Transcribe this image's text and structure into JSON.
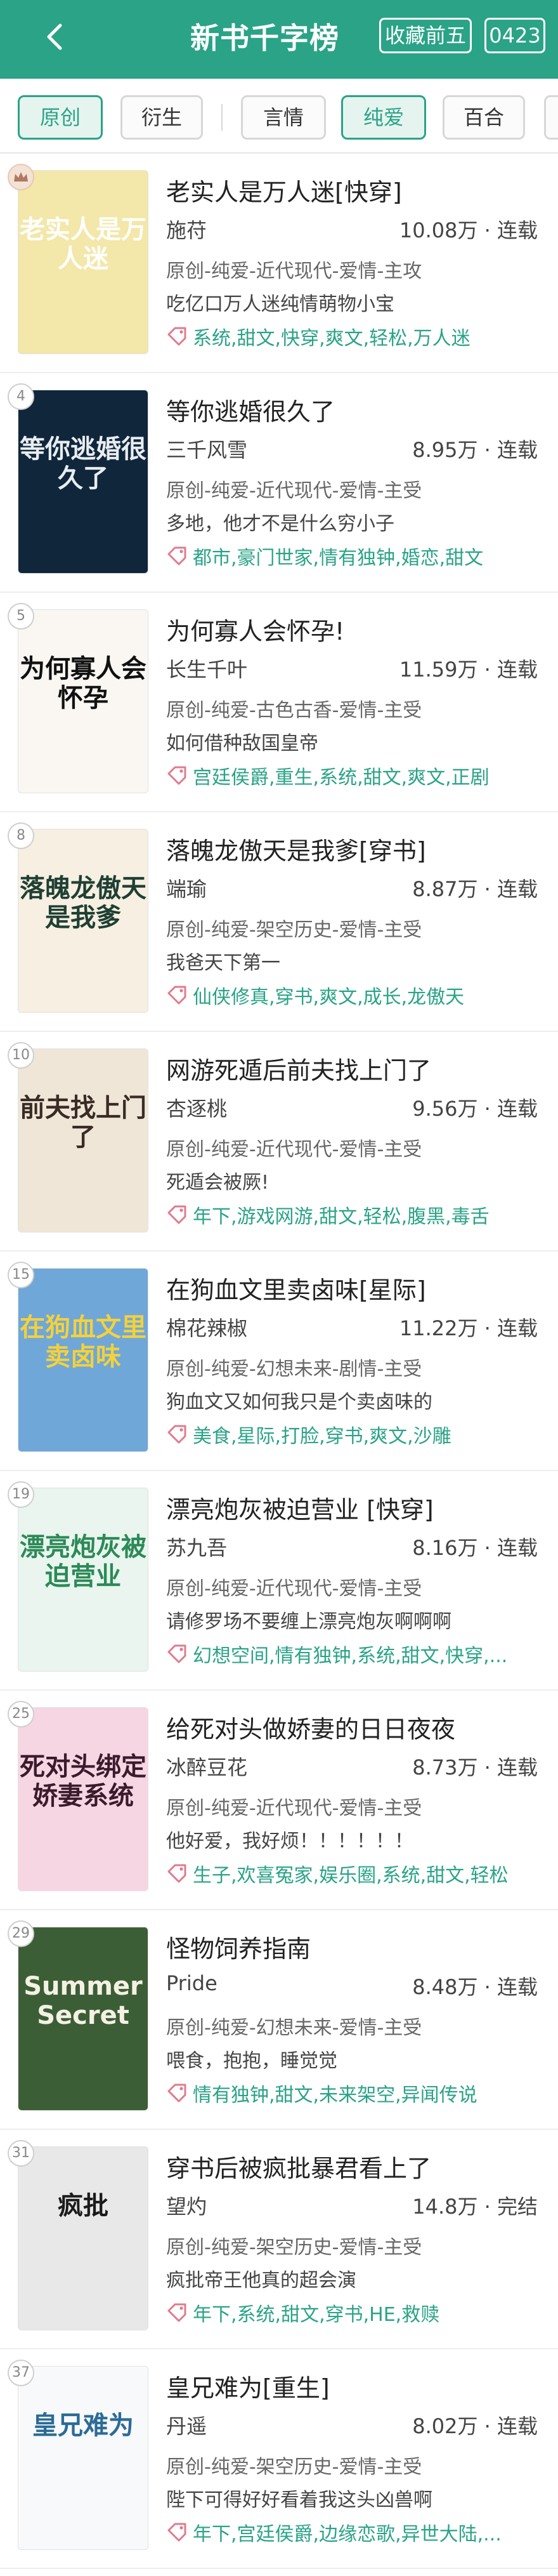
{
  "header": {
    "title": "新书千字榜",
    "left_badge": "收藏前五",
    "right_badge": "0423"
  },
  "tabs": [
    "原创",
    "衍生",
    "言情",
    "纯爱",
    "百合",
    ""
  ],
  "books": [
    {
      "rank": "",
      "title": "老实人是万人迷[快穿]",
      "author": "施苻",
      "stats": "10.08万 · 连载",
      "genre": "原创-纯爱-近代现代-爱情-主攻",
      "intro": "吃亿口万人迷纯情萌物小宝",
      "tags": "系统,甜文,快穿,爽文,轻松,万人迷",
      "cover": {
        "text": "老实人是万人迷",
        "bg": "#f3e7a9",
        "fg": "#ffffff"
      }
    },
    {
      "rank": "4",
      "title": "等你逃婚很久了",
      "author": "三千风雪",
      "stats": "8.95万 · 连载",
      "genre": "原创-纯爱-近代现代-爱情-主受",
      "intro": "多地，他才不是什么穷小子",
      "tags": "都市,豪门世家,情有独钟,婚恋,甜文",
      "cover": {
        "text": "等你逃婚很久了",
        "bg": "#10263a",
        "fg": "#e8edf2"
      }
    },
    {
      "rank": "5",
      "title": "为何寡人会怀孕!",
      "author": "长生千叶",
      "stats": "11.59万 · 连载",
      "genre": "原创-纯爱-古色古香-爱情-主受",
      "intro": "如何借种敌国皇帝",
      "tags": "宫廷侯爵,重生,系统,甜文,爽文,正剧",
      "cover": {
        "text": "为何寡人会怀孕",
        "bg": "#faf7f2",
        "fg": "#111111"
      }
    },
    {
      "rank": "8",
      "title": "落魄龙傲天是我爹[穿书]",
      "author": "端瑜",
      "stats": "8.87万 · 连载",
      "genre": "原创-纯爱-架空历史-爱情-主受",
      "intro": "我爸天下第一",
      "tags": "仙侠修真,穿书,爽文,成长,龙傲天",
      "cover": {
        "text": "落魄龙傲天是我爹",
        "bg": "#f6efe2",
        "fg": "#1f3f33"
      }
    },
    {
      "rank": "10",
      "title": "网游死遁后前夫找上门了",
      "author": "杏逐桃",
      "stats": "9.56万 · 连载",
      "genre": "原创-纯爱-近代现代-爱情-主受",
      "intro": "死遁会被厥!",
      "tags": "年下,游戏网游,甜文,轻松,腹黑,毒舌",
      "cover": {
        "text": "前夫找上门了",
        "bg": "#efe6d8",
        "fg": "#3a2b24"
      }
    },
    {
      "rank": "15",
      "title": "在狗血文里卖卤味[星际]",
      "author": "棉花辣椒",
      "stats": "11.22万 · 连载",
      "genre": "原创-纯爱-幻想未来-剧情-主受",
      "intro": "狗血文又如何我只是个卖卤味的",
      "tags": "美食,星际,打脸,穿书,爽文,沙雕",
      "cover": {
        "text": "在狗血文里卖卤味",
        "bg": "#6fa7d8",
        "fg": "#f4d13b"
      }
    },
    {
      "rank": "19",
      "title": "漂亮炮灰被迫营业 [快穿]",
      "author": "苏九吾",
      "stats": "8.16万 · 连载",
      "genre": "原创-纯爱-近代现代-爱情-主受",
      "intro": "请修罗场不要缠上漂亮炮灰啊啊啊",
      "tags": "幻想空间,情有独钟,系统,甜文,快穿,...",
      "cover": {
        "text": "漂亮炮灰被迫营业",
        "bg": "#e9f5ee",
        "fg": "#2b8a57"
      }
    },
    {
      "rank": "25",
      "title": "给死对头做娇妻的日日夜夜",
      "author": "冰醉豆花",
      "stats": "8.73万 · 连载",
      "genre": "原创-纯爱-近代现代-爱情-主受",
      "intro": "他好爱，我好烦！！！！！！",
      "tags": "生子,欢喜冤家,娱乐圈,系统,甜文,轻松",
      "cover": {
        "text": "死对头绑定娇妻系统",
        "bg": "#f6d6e3",
        "fg": "#3a1b2b"
      }
    },
    {
      "rank": "29",
      "title": "怪物饲养指南",
      "author": "Pride",
      "stats": "8.48万 · 连载",
      "genre": "原创-纯爱-幻想未来-爱情-主受",
      "intro": "喂食，抱抱，睡觉觉",
      "tags": "情有独钟,甜文,未来架空,异闻传说",
      "cover": {
        "text": "Summer Secret",
        "bg": "#3c5e36",
        "fg": "#f4f1e4"
      }
    },
    {
      "rank": "31",
      "title": "穿书后被疯批暴君看上了",
      "author": "望灼",
      "stats": "14.8万 · 完结",
      "genre": "原创-纯爱-架空历史-爱情-主受",
      "intro": "疯批帝王他真的超会演",
      "tags": "年下,系统,甜文,穿书,HE,救赎",
      "cover": {
        "text": "疯批",
        "bg": "#e8e8e8",
        "fg": "#1b1b1b"
      }
    },
    {
      "rank": "37",
      "title": "皇兄难为[重生]",
      "author": "丹遥",
      "stats": "8.02万 · 连载",
      "genre": "原创-纯爱-架空历史-爱情-主受",
      "intro": "陛下可得好好看着我这头凶兽啊",
      "tags": "年下,宫廷侯爵,边缘恋歌,异世大陆,...",
      "cover": {
        "text": "皇兄难为",
        "bg": "#f7f9fb",
        "fg": "#2c6b96"
      }
    }
  ],
  "icons": {
    "back": "chevron-left-icon",
    "tag": "tag-icon",
    "crown": "crown-icon"
  },
  "colors": {
    "accent": "#2aa387"
  }
}
